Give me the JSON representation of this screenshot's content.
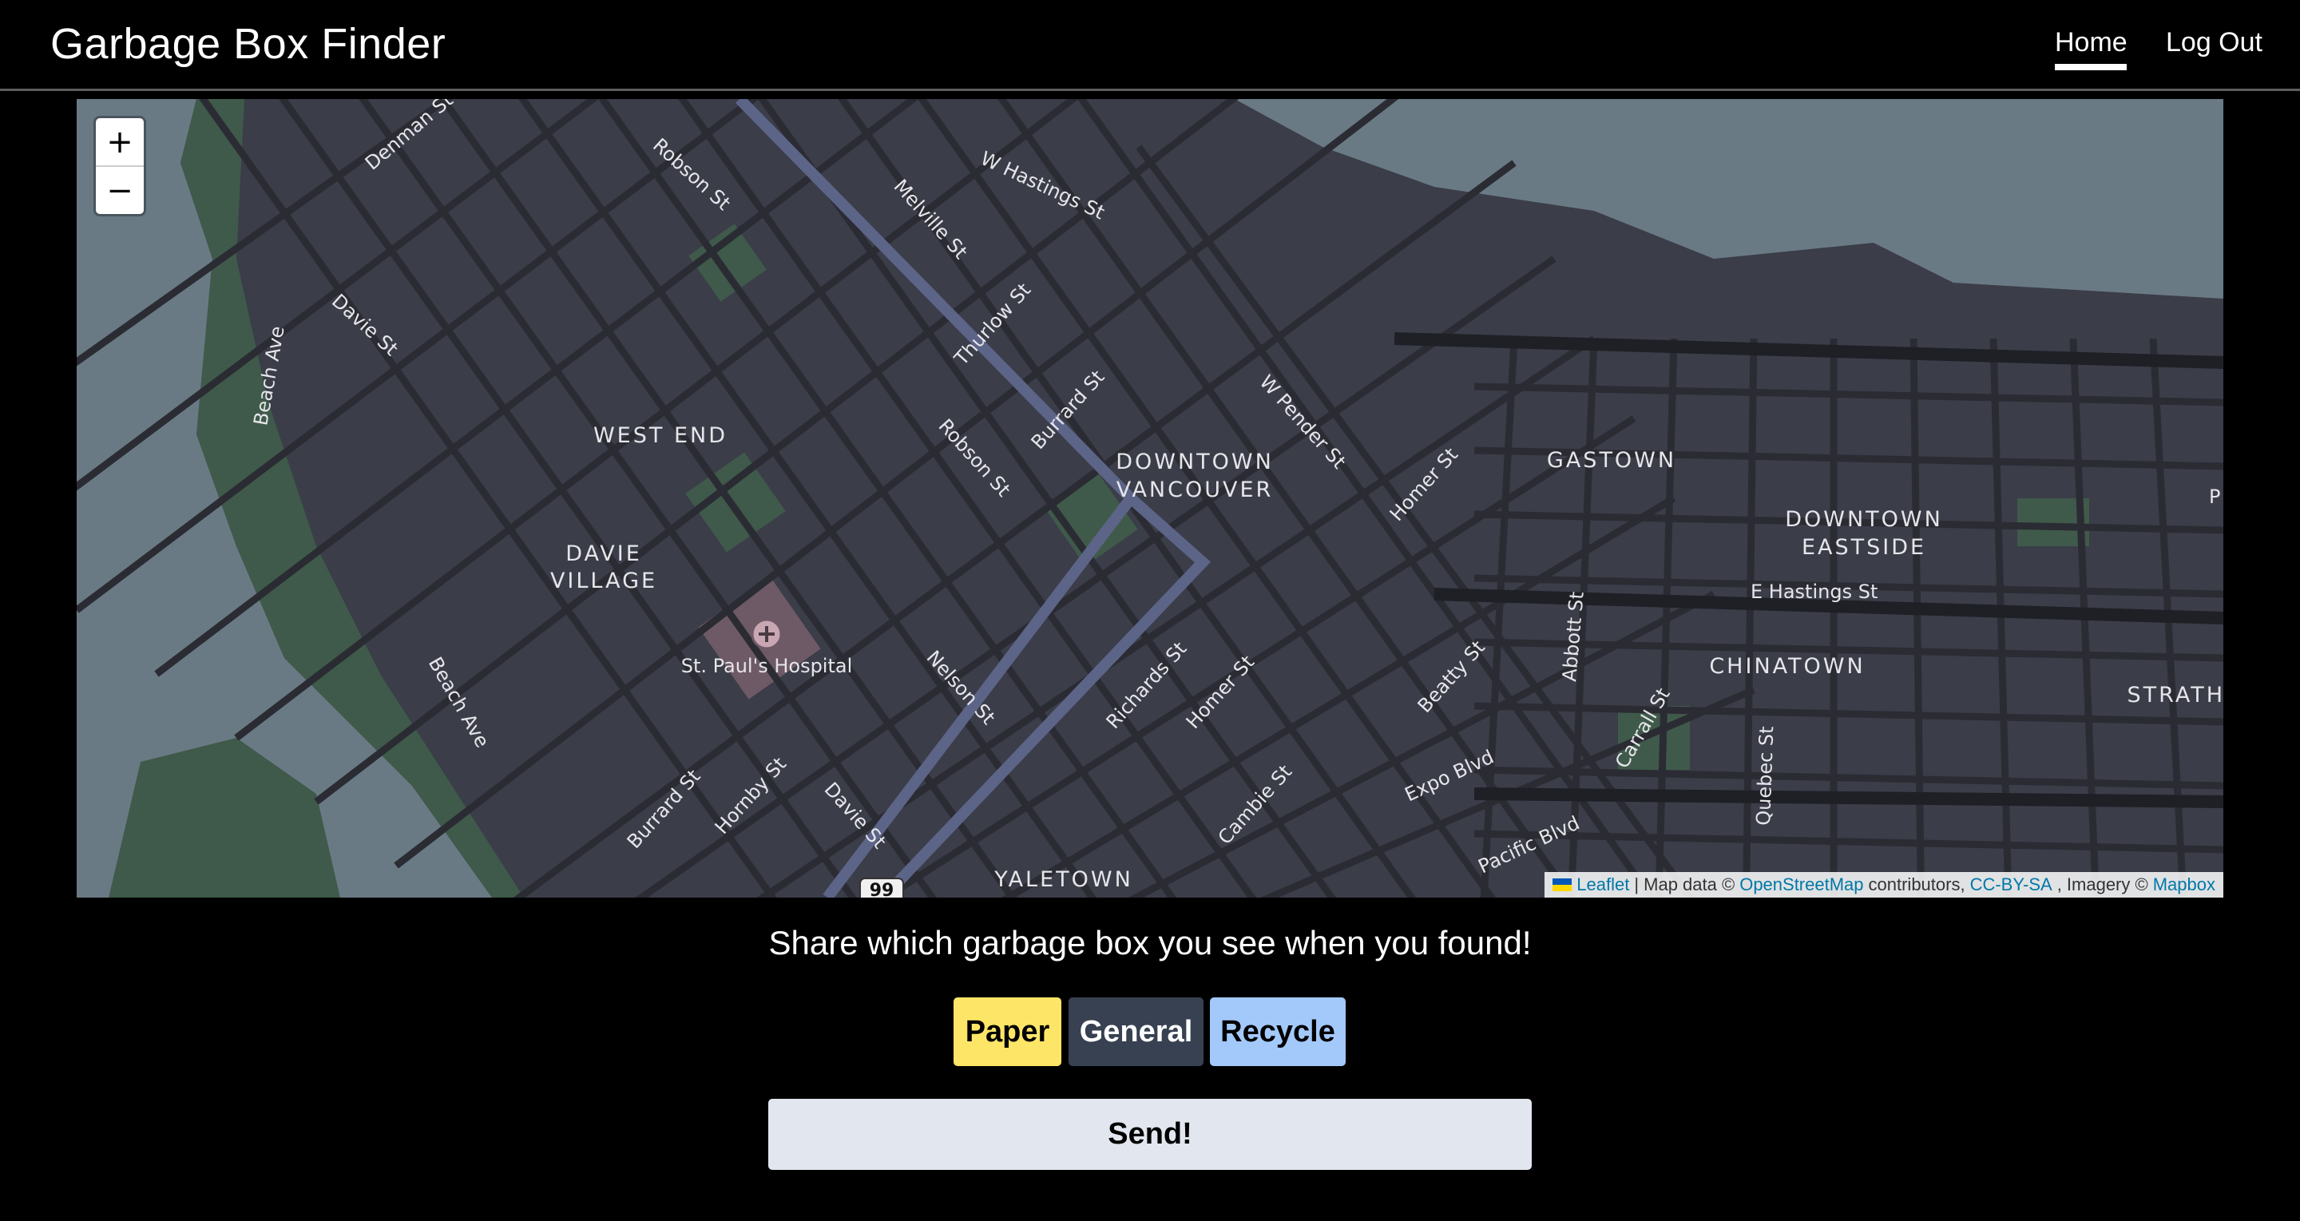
{
  "app": {
    "title": "Garbage Box Finder"
  },
  "nav": {
    "home": "Home",
    "logout": "Log Out"
  },
  "map": {
    "zoom_in": "+",
    "zoom_out": "−",
    "districts": [
      "WEST END",
      "DAVIE",
      "VILLAGE",
      "DOWNTOWN",
      "VANCOUVER",
      "GASTOWN",
      "DOWNTOWN",
      "EASTSIDE",
      "CHINATOWN",
      "YALETOWN",
      "STRATH"
    ],
    "streets": [
      "Denman St",
      "Robson St",
      "W Hastings St",
      "Melville St",
      "Davie St",
      "Beach Ave",
      "Thurlow St",
      "Burrard St",
      "Robson St",
      "W Pender St",
      "Homer St",
      "Abbott St",
      "E Hastings St",
      "Nelson St",
      "Richards St",
      "Homer St",
      "Beatty St",
      "Carrall St",
      "Quebec St",
      "Beach Ave",
      "Burrard St",
      "Hornby St",
      "Davie St",
      "Cambie St",
      "Expo Blvd",
      "Pacific Blvd",
      "P"
    ],
    "poi": "St. Paul's Hospital",
    "route_badge": "99",
    "attribution": {
      "leaflet": "Leaflet",
      "sep1": "| Map data ©",
      "osm": "OpenStreetMap",
      "contributors": "contributors,",
      "license": "CC-BY-SA",
      "imagery": ", Imagery ©",
      "mapbox": "Mapbox"
    }
  },
  "prompt": "Share which garbage box you see when you found!",
  "types": {
    "paper": "Paper",
    "general": "General",
    "recycle": "Recycle"
  },
  "send": "Send!",
  "colors": {
    "paper": "#fde568",
    "general": "#374151",
    "recycle": "#a3c9fb",
    "send": "#e2e7ef"
  }
}
